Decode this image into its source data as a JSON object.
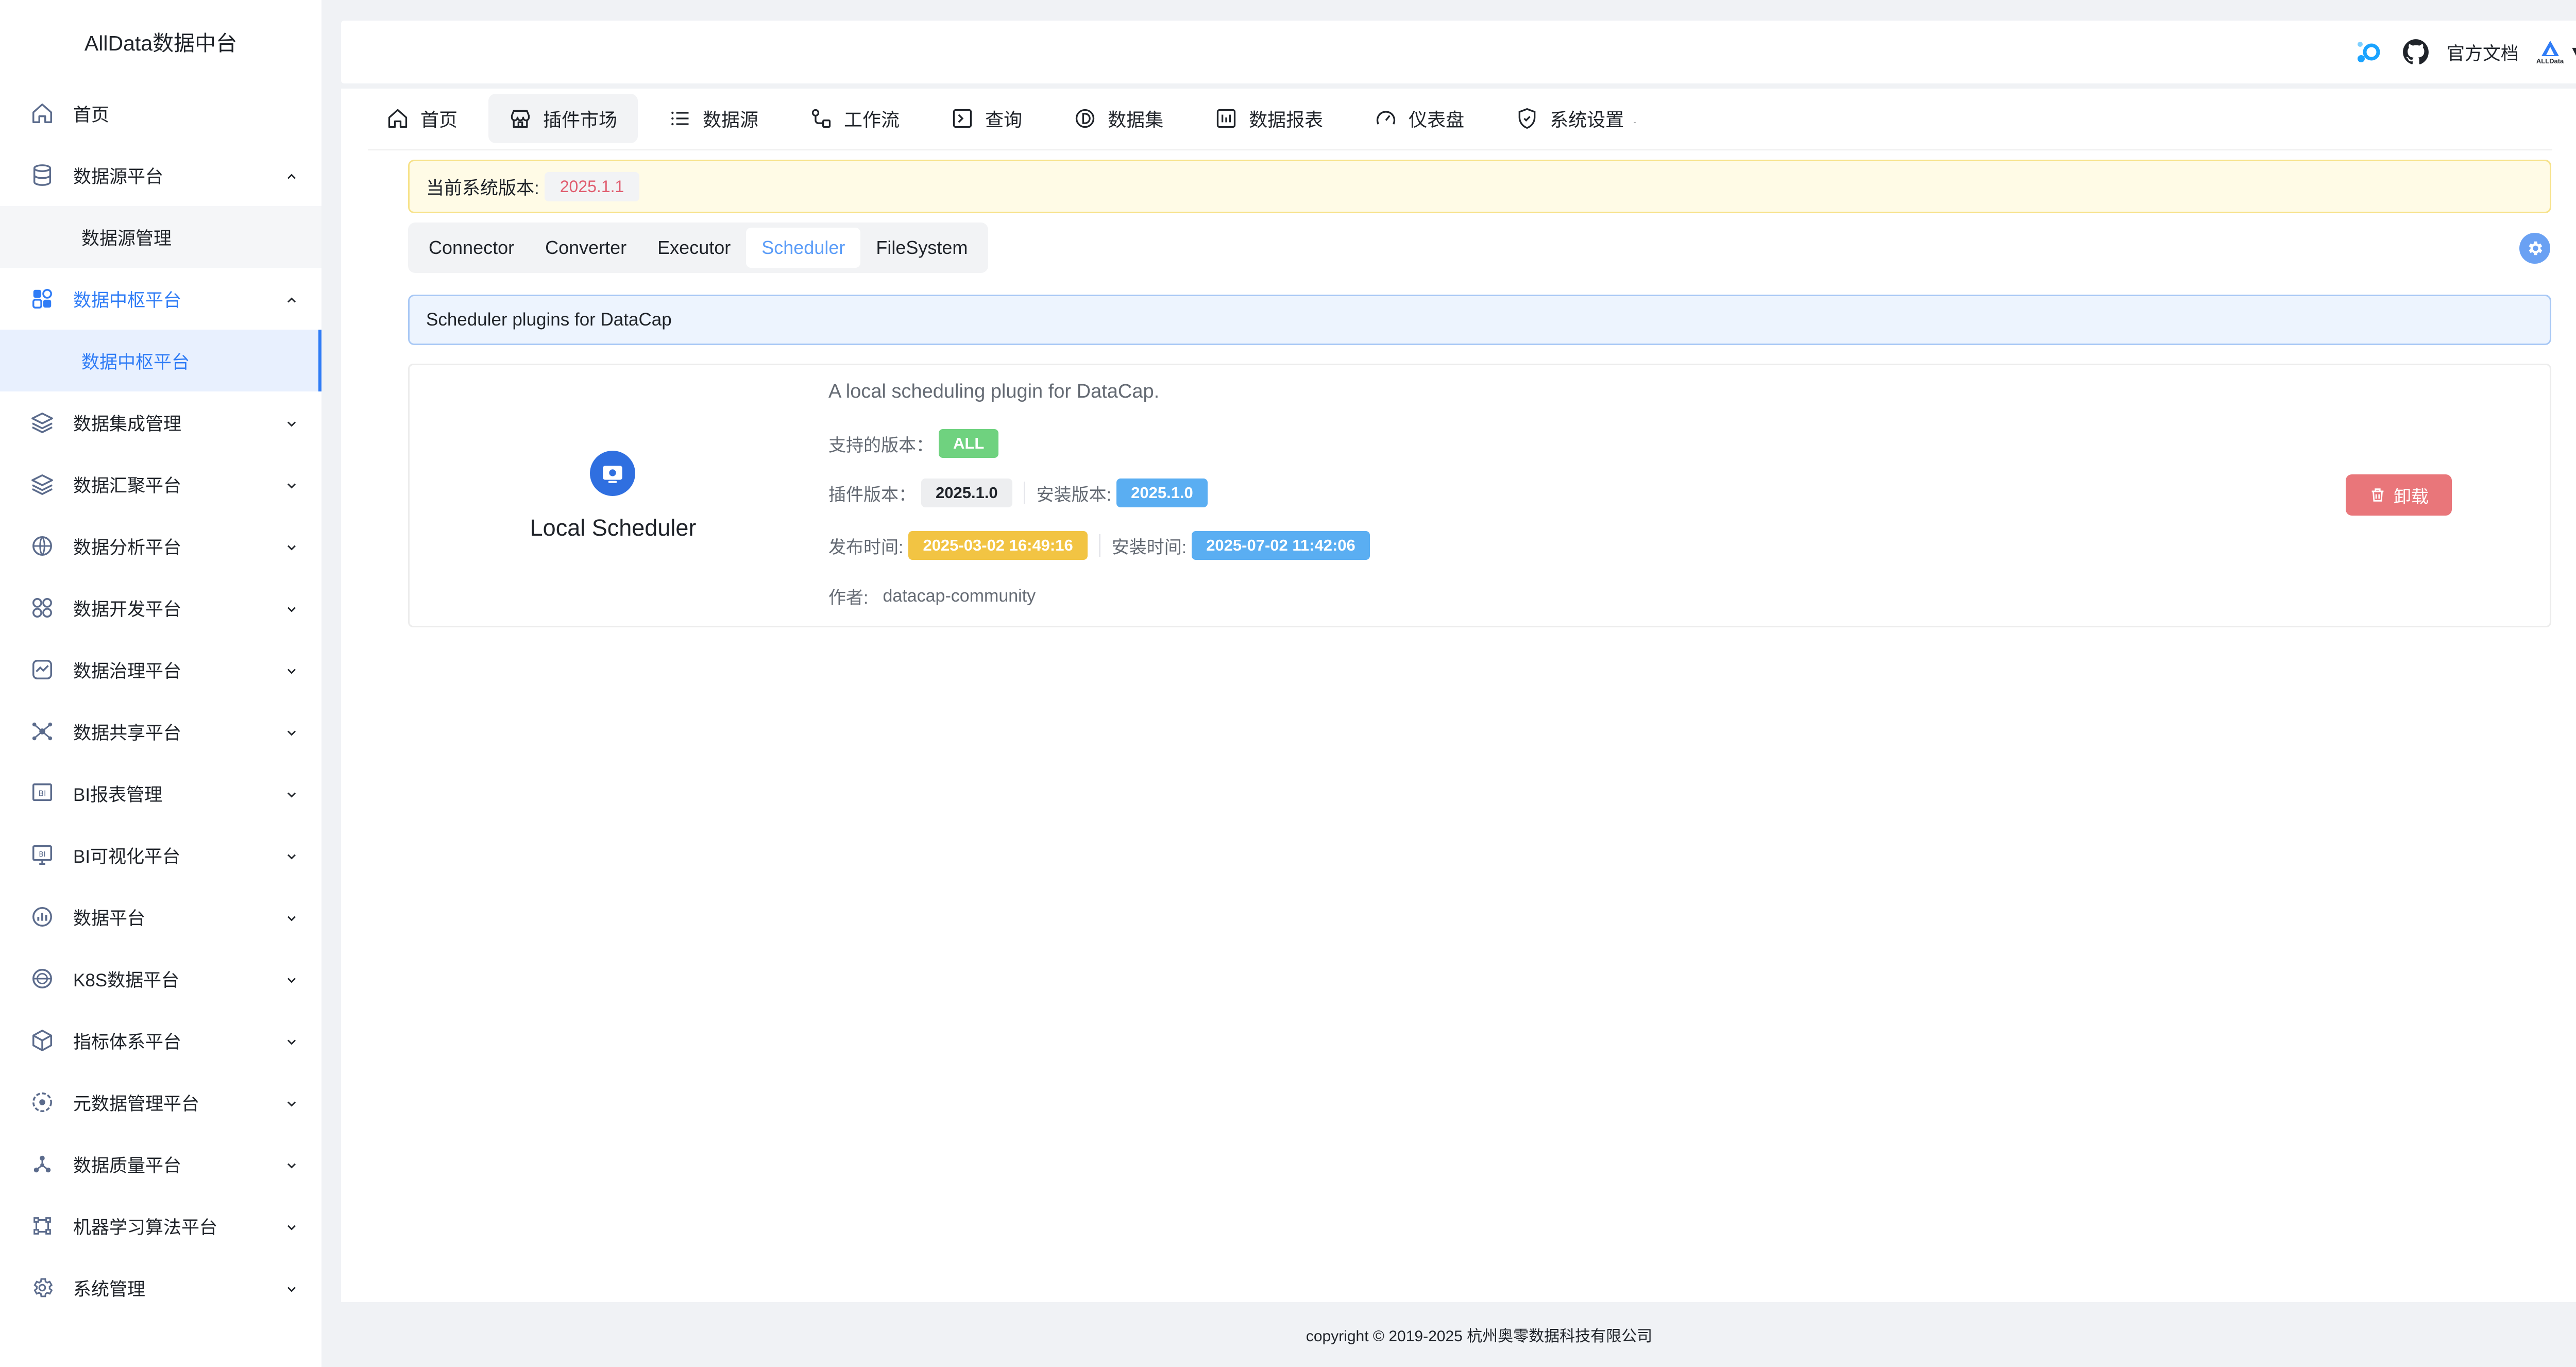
{
  "app": {
    "title": "AllData数据中台"
  },
  "sidebar": {
    "items": [
      {
        "label": "首页",
        "icon": "home-icon"
      },
      {
        "label": "数据源平台",
        "icon": "database-icon",
        "expanded": true
      },
      {
        "label": "数据源管理",
        "sub": true
      },
      {
        "label": "数据中枢平台",
        "icon": "grid-shapes-icon",
        "expanded": true,
        "active": true
      },
      {
        "label": "数据中枢平台",
        "sub": true,
        "active": true
      },
      {
        "label": "数据集成管理",
        "icon": "layers-icon"
      },
      {
        "label": "数据汇聚平台",
        "icon": "layers-icon"
      },
      {
        "label": "数据分析平台",
        "icon": "globe-icon"
      },
      {
        "label": "数据开发平台",
        "icon": "apps-icon"
      },
      {
        "label": "数据治理平台",
        "icon": "shield-chart-icon"
      },
      {
        "label": "数据共享平台",
        "icon": "share-network-icon"
      },
      {
        "label": "BI报表管理",
        "icon": "bi-report-icon"
      },
      {
        "label": "BI可视化平台",
        "icon": "bi-screen-icon"
      },
      {
        "label": "数据平台",
        "icon": "bar-chart-icon"
      },
      {
        "label": "K8S数据平台",
        "icon": "k8s-icon"
      },
      {
        "label": "指标体系平台",
        "icon": "cube-icon"
      },
      {
        "label": "元数据管理平台",
        "icon": "metadata-icon"
      },
      {
        "label": "数据质量平台",
        "icon": "molecule-icon"
      },
      {
        "label": "机器学习算法平台",
        "icon": "ml-icon"
      },
      {
        "label": "系统管理",
        "icon": "settings-icon"
      }
    ]
  },
  "topbar": {
    "docs_label": "官方文档",
    "logo_text": "ALLData"
  },
  "nav": {
    "items": [
      {
        "label": "首页",
        "icon": "home-icon"
      },
      {
        "label": "插件市场",
        "icon": "store-icon",
        "active": true
      },
      {
        "label": "数据源",
        "icon": "list-icon"
      },
      {
        "label": "工作流",
        "icon": "workflow-icon"
      },
      {
        "label": "查询",
        "icon": "terminal-icon"
      },
      {
        "label": "数据集",
        "icon": "dataset-icon"
      },
      {
        "label": "数据报表",
        "icon": "report-icon"
      },
      {
        "label": "仪表盘",
        "icon": "gauge-icon"
      },
      {
        "label": "系统设置",
        "icon": "shield-icon",
        "has_dropdown": true
      }
    ]
  },
  "version": {
    "label": "当前系统版本:",
    "value": "2025.1.1"
  },
  "tabs": [
    "Connector",
    "Converter",
    "Executor",
    "Scheduler",
    "FileSystem"
  ],
  "active_tab": "Scheduler",
  "description": "Scheduler plugins for DataCap",
  "plugin": {
    "name": "Local Scheduler",
    "description": "A local scheduling plugin for DataCap.",
    "supported_label": "支持的版本：",
    "supported_value": "ALL",
    "plugin_version_label": "插件版本：",
    "plugin_version": "2025.1.0",
    "install_version_label": "安装版本:",
    "install_version": "2025.1.0",
    "release_time_label": "发布时间:",
    "release_time": "2025-03-02 16:49:16",
    "install_time_label": "安装时间:",
    "install_time": "2025-07-02 11:42:06",
    "author_label": "作者:",
    "author": "datacap-community",
    "uninstall_label": "卸载"
  },
  "footer": {
    "copyright": "copyright © 2019-2025 杭州奥零数据科技有限公司"
  },
  "colors": {
    "accent": "#2f7cf6",
    "danger": "#e9767a",
    "success": "#6fd27f",
    "warning": "#f2c443"
  }
}
